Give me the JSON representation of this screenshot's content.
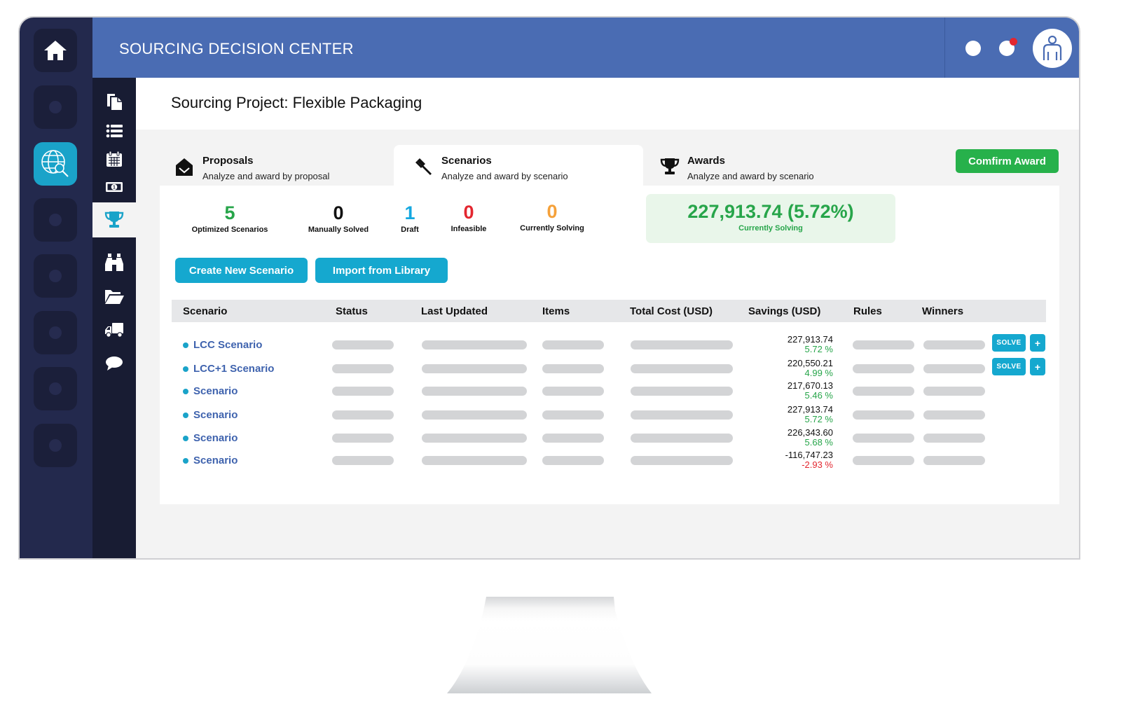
{
  "app": {
    "title": "SOURCING DECISION CENTER"
  },
  "header": {
    "notification_badge_color": "#e3262f",
    "icons": [
      "status-dot-icon",
      "notification-dot-icon",
      "user-avatar-icon"
    ]
  },
  "rail": {
    "items": [
      {
        "icon": "home-icon",
        "active": false
      },
      {
        "icon": "placeholder-dot-icon",
        "active": false
      },
      {
        "icon": "globe-search-icon",
        "active": true
      },
      {
        "icon": "placeholder-dot-icon",
        "active": false
      },
      {
        "icon": "placeholder-dot-icon",
        "active": false
      },
      {
        "icon": "placeholder-dot-icon",
        "active": false
      },
      {
        "icon": "placeholder-dot-icon",
        "active": false
      },
      {
        "icon": "placeholder-dot-icon",
        "active": false
      }
    ]
  },
  "subnav": {
    "items": [
      {
        "icon": "documents-icon"
      },
      {
        "icon": "list-icon"
      },
      {
        "icon": "calendar-icon"
      },
      {
        "icon": "money-icon"
      },
      {
        "icon": "trophy-icon",
        "active": true
      },
      {
        "icon": "binoculars-icon"
      },
      {
        "icon": "folder-open-icon"
      },
      {
        "icon": "truck-icon"
      },
      {
        "icon": "chat-bubble-icon"
      }
    ]
  },
  "page": {
    "title": "Sourcing Project: Flexible Packaging"
  },
  "tabs": [
    {
      "name": "Proposals",
      "description": "Analyze and award by proposal",
      "icon": "envelope-open-icon",
      "active": false
    },
    {
      "name": "Scenarios",
      "description": "Analyze and award by scenario",
      "icon": "gavel-icon",
      "active": true
    },
    {
      "name": "Awards",
      "description": "Analyze and award by scenario",
      "icon": "trophy-icon",
      "active": false
    }
  ],
  "confirm_award_label": "Comfirm Award",
  "stats": [
    {
      "value": "5",
      "label": "Optimized Scenarios",
      "color": "#27a54a"
    },
    {
      "value": "0",
      "label": "Manually Solved",
      "color": "#111111"
    },
    {
      "value": "1",
      "label": "Draft",
      "color": "#15a8e0"
    },
    {
      "value": "0",
      "label": "Infeasible",
      "color": "#e3262f"
    },
    {
      "value": "0",
      "label": "Currently Solving",
      "color": "#f5a13a"
    }
  ],
  "summary": {
    "value": "227,913.74 (5.72%)",
    "label": "Currently Solving"
  },
  "buttons": {
    "create": "Create New Scenario",
    "import": "Import from Library"
  },
  "table": {
    "columns": [
      "Scenario",
      "Status",
      "Last Updated",
      "Items",
      "Total Cost (USD)",
      "Savings (USD)",
      "Rules",
      "Winners"
    ],
    "rows": [
      {
        "name": "LCC Scenario",
        "savings": "227,913.74",
        "pct": "5.72 %",
        "pct_color": "#27a54a",
        "actions": true
      },
      {
        "name": "LCC+1 Scenario",
        "savings": "220,550.21",
        "pct": "4.99 %",
        "pct_color": "#27a54a",
        "actions": true
      },
      {
        "name": "Scenario",
        "savings": "217,670.13",
        "pct": "5.46 %",
        "pct_color": "#27a54a",
        "actions": false
      },
      {
        "name": "Scenario",
        "savings": "227,913.74",
        "pct": "5.72 %",
        "pct_color": "#27a54a",
        "actions": false
      },
      {
        "name": "Scenario",
        "savings": "226,343.60",
        "pct": "5.68 %",
        "pct_color": "#27a54a",
        "actions": false
      },
      {
        "name": "Scenario",
        "savings": "-116,747.23",
        "pct": "-2.93 %",
        "pct_color": "#e3262f",
        "actions": false
      }
    ],
    "solve_label": "SOLVE",
    "add_label": "+"
  }
}
